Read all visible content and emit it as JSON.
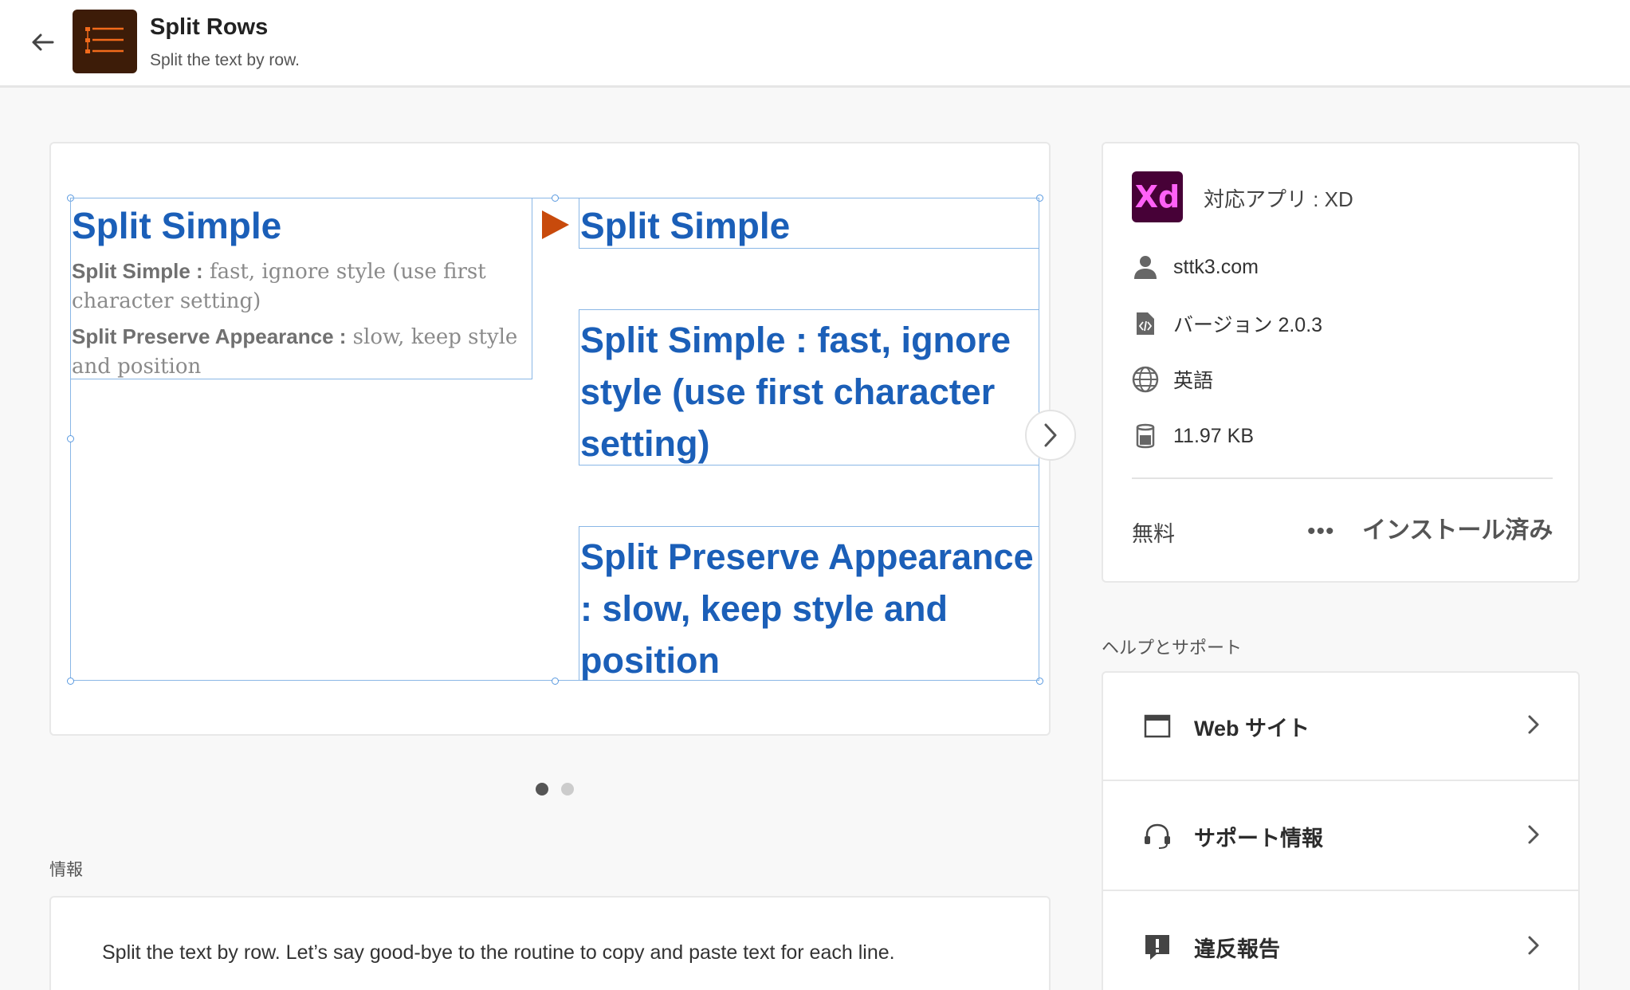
{
  "header": {
    "title": "Split Rows",
    "subtitle": "Split the text by row."
  },
  "preview": {
    "left_title": "Split Simple",
    "left_line1_bold": "Split Simple :",
    "left_line1_rest": " fast, ignore style (use first character setting)",
    "left_line2_bold": "Split Preserve Appearance :",
    "left_line2_rest": " slow, keep style and position",
    "right_item1": "Split Simple",
    "right_item2": "Split Simple : fast, ignore style (use first character setting)",
    "right_item3": "Split Preserve Appearance : slow, keep style and position",
    "arrow_color": "#c84a0c",
    "heading_color": "#1b5fb8"
  },
  "carousel": {
    "pages": 2,
    "active": 1
  },
  "info": {
    "label": "情報",
    "text": "Split the text by row. Let’s say good-bye to the routine to copy and paste text for each line."
  },
  "meta": {
    "app_badge": "Xd",
    "compat": "対応アプリ : XD",
    "author": "sttk3.com",
    "version": "バージョン 2.0.3",
    "language": "英語",
    "size": "11.97 KB",
    "price": "無料",
    "more": "•••",
    "installed": "インストール済み"
  },
  "help": {
    "label": "ヘルプとサポート",
    "items": [
      {
        "label": "Web サイト",
        "icon": "browser-window-icon"
      },
      {
        "label": "サポート情報",
        "icon": "headset-icon"
      },
      {
        "label": "違反報告",
        "icon": "alert-flag-icon"
      }
    ]
  }
}
